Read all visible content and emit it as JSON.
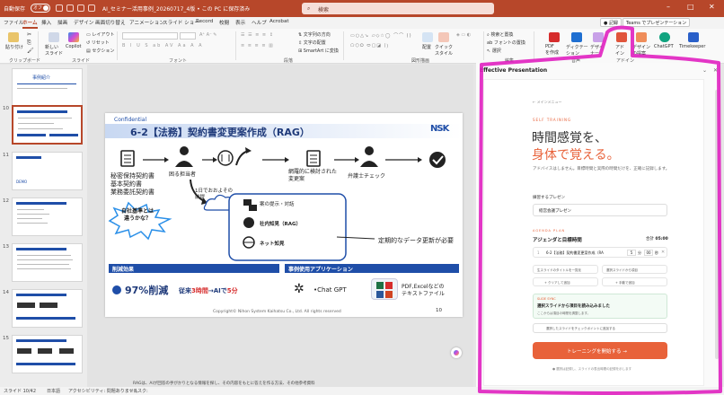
{
  "titlebar": {
    "autosave_label": "自動保存",
    "autosave_state": "オフ",
    "doc_title": "AI_セミナー活用事例_20260717_4版 • この PC に保存済み",
    "search_placeholder": "検索",
    "bg_color": "#b7472a"
  },
  "tabs": [
    {
      "label": "ファイル"
    },
    {
      "label": "ホーム"
    },
    {
      "label": "挿入"
    },
    {
      "label": "描画"
    },
    {
      "label": "デザイン"
    },
    {
      "label": "画面切り替え"
    },
    {
      "label": "アニメーション"
    },
    {
      "label": "スライド ショー"
    },
    {
      "label": "Record"
    },
    {
      "label": "校閲"
    },
    {
      "label": "表示"
    },
    {
      "label": "ヘルプ"
    },
    {
      "label": "Acrobat"
    }
  ],
  "tabs_right": {
    "record": "記録",
    "teams": "Teams でプレゼンテーション"
  },
  "ribbon": {
    "paste": "貼り付け",
    "new_slide": "新しい\nスライド",
    "copilot": "Copilot",
    "layout": "レイアウト",
    "reset": "リセット",
    "section": "セクション",
    "text_dir": "文字列の方向",
    "text_align": "文字の配置",
    "smartart": "SmartArt に変換",
    "arrange": "配置",
    "quick_style": "クイック\nスタイル",
    "find": "検索と置換",
    "font_replace": "フォントの置換",
    "select": "選択",
    "pdf_create": "PDF\nを作成",
    "dictation": "ディクテー\nション",
    "designer": "デザイ\nナー",
    "addin": "アド\nイン",
    "design_idea": "デザイン\nの提案",
    "chatgpt": "ChatGPT",
    "timekeeper": "Timekeeper",
    "groups": {
      "clipboard": "クリップボード",
      "slide": "スライド",
      "font": "フォント",
      "paragraph": "段落",
      "drawing": "図形描画",
      "edit": "編集",
      "voice": "音声",
      "addin": "アドイン"
    }
  },
  "thumbnails": [
    {
      "num": "",
      "type": "title",
      "title": "事例紹介"
    },
    {
      "num": "10",
      "type": "diagram",
      "selected": true
    },
    {
      "num": "11",
      "type": "blank"
    },
    {
      "num": "12",
      "type": "list"
    },
    {
      "num": "13",
      "type": "list"
    },
    {
      "num": "14",
      "type": "diagram"
    },
    {
      "num": "15",
      "type": "diagram"
    }
  ],
  "slide": {
    "confidential": "Confidential",
    "title": "6-2【法務】契約書変更案作成（RAG）",
    "logo": "NSK",
    "doc_list": [
      "秘密保持契約書",
      "基本契約書",
      "業務委託契約書"
    ],
    "person1_label": "困る担当者",
    "cloud_label": "1日でおおよその\n前提",
    "starburst": "自社基準とは\n違うかな？",
    "callout_items": [
      "案の提示・対話",
      "社内知見（RAG）",
      "ネット知見"
    ],
    "rev_label": "網羅的に検討された\n変更案",
    "person2_label": "弁護士チェック",
    "update_label": "定期的なデータ更新が必要",
    "effect_header": "削減効果",
    "effect_value": "97%削減",
    "effect_detail_pre": "従来",
    "effect_hours": "3時間",
    "effect_arrow": "→AIで",
    "effect_minutes": "5分",
    "app_header": "事例使用アプリケーション",
    "app_chatgpt": "Chat GPT",
    "app_files": "PDF,Excelなどの\nテキストファイル",
    "copyright": "Copyright© Nihon System Kaihatsu Co., Ltd. All rights reserved",
    "page": "10",
    "accent": "#1f4ea8"
  },
  "pane": {
    "title": "Effective Presentation",
    "nav": "← メインメニュー",
    "kicker": "SELF TRAINING",
    "headline1": "時間感覚を、",
    "headline2": "身体で覚える。",
    "desc": "アドバイスはしません。目標時間と実際の時間だけを、正確に記録します。",
    "section_label": "練習するプレゼン",
    "presentation_value": "経営会議プレゼン",
    "agenda_kicker": "AGENDA PLAN",
    "agenda_title": "アジェンダと目標時間",
    "total_label": "合計",
    "total_value": "05:00",
    "agenda_item": "6-2【法務】契約書変更案作成（RA",
    "agenda_unit_min": "分",
    "agenda_min": "5",
    "agenda_unit_sec": "秒",
    "agenda_sec": "00",
    "btn_add_current": "生スライドのタイトルを一覧化",
    "btn_add_selected": "選択スライドから項目",
    "btn_clear": "+ クリアして追加",
    "btn_manual": "+ 手動で追加",
    "sync_kicker": "SLIDE SYNC",
    "sync_title": "選択スライドから項目を読み込みました",
    "sync_desc": "ここからは項目の時間を調整します。",
    "secondary_btn": "選択したスライドをチェックポイントに追加する",
    "start_btn": "トレーニングを開始する  →",
    "footer": "● 選択は記録し、スライドの表出時間の記録を示します",
    "accent": "#e8623a"
  },
  "statusbar": {
    "slide_info": "スライド 10/42",
    "lang": "日本語",
    "accessibility": "アクセシビリティ: 問題ありません",
    "notes": "リスク:",
    "notes2": "RAGは、AIが回答の手がかりとなる情報を探し、その内容をもとに答えを作る方法、その他参考資料"
  }
}
